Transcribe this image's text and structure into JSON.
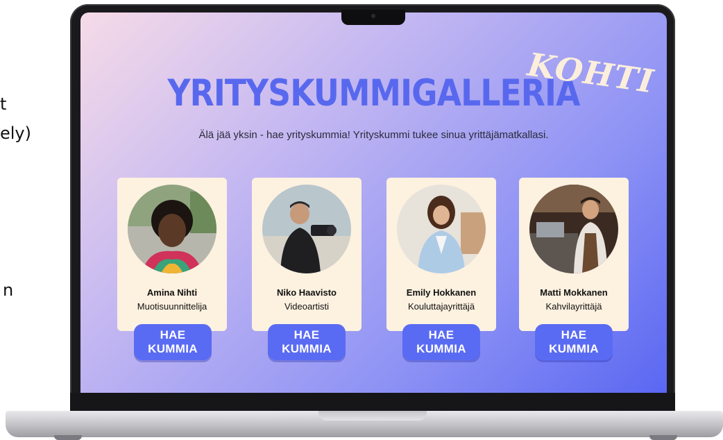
{
  "background_fragments": {
    "line1": "t",
    "line2": "ely)",
    "line3": "n"
  },
  "hero": {
    "title": "YRITYSKUMMIGALLERIA",
    "badge": "KOHTI",
    "subtitle": "Älä jää yksin - hae yrityskummia! Yrityskummi tukee sinua yrittäjämatkallasi."
  },
  "colors": {
    "accent": "#5868ee",
    "button": "#5a6bf3",
    "card": "#fdf1e0"
  },
  "mentors": [
    {
      "name": "Amina Nihti",
      "role": "Muotisuunnittelija",
      "button": "HAE KUMMIA"
    },
    {
      "name": "Niko Haavisto",
      "role": "Videoartisti",
      "button": "HAE KUMMIA"
    },
    {
      "name": "Emily Hokkanen",
      "role": "Kouluttajayrittäjä",
      "button": "HAE KUMMIA"
    },
    {
      "name": "Matti Mokkanen",
      "role": "Kahvilayrittäjä",
      "button": "HAE KUMMIA"
    }
  ]
}
